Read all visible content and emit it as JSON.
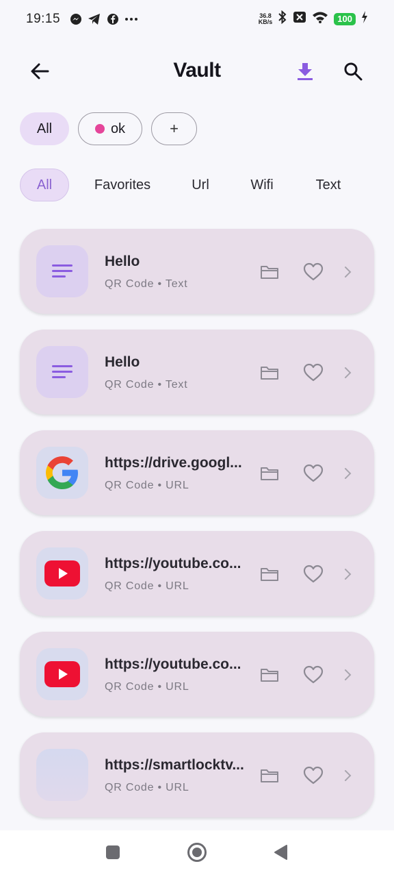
{
  "status_bar": {
    "time": "19:15",
    "net_speed_value": "36.8",
    "net_speed_unit": "KB/s",
    "battery": "100",
    "icons": [
      "messenger-icon",
      "telegram-icon",
      "facebook-icon",
      "more-dots-icon",
      "bluetooth-icon",
      "sim-off-icon",
      "wifi-icon",
      "battery-icon",
      "charging-icon"
    ]
  },
  "app_bar": {
    "title": "Vault",
    "icons": [
      "back-arrow-icon",
      "download-icon",
      "search-icon"
    ],
    "accent_color": "#8a5ce0"
  },
  "folder_chips": {
    "all_label": "All",
    "ok_label": "ok",
    "ok_dot_color": "#e5459a",
    "add_label": "+"
  },
  "type_tabs": [
    {
      "label": "All",
      "active": true
    },
    {
      "label": "Favorites",
      "active": false
    },
    {
      "label": "Url",
      "active": false
    },
    {
      "label": "Wifi",
      "active": false
    },
    {
      "label": "Text",
      "active": false
    }
  ],
  "items": [
    {
      "title": "Hello",
      "subtitle": "QR Code • Text",
      "icon": "text-lines-icon"
    },
    {
      "title": "Hello",
      "subtitle": "QR Code • Text",
      "icon": "text-lines-icon"
    },
    {
      "title": "https://drive.googl...",
      "subtitle": "QR Code • URL",
      "icon": "google-logo-icon"
    },
    {
      "title": "https://youtube.co...",
      "subtitle": "QR Code • URL",
      "icon": "youtube-logo-icon"
    },
    {
      "title": "https://youtube.co...",
      "subtitle": "QR Code • URL",
      "icon": "youtube-logo-icon"
    },
    {
      "title": "https://smartlocktv...",
      "subtitle": "QR Code • URL",
      "icon": "blank-icon"
    }
  ],
  "nav_bar": {
    "icons": [
      "recents-square-icon",
      "home-circle-icon",
      "back-triangle-icon"
    ]
  }
}
